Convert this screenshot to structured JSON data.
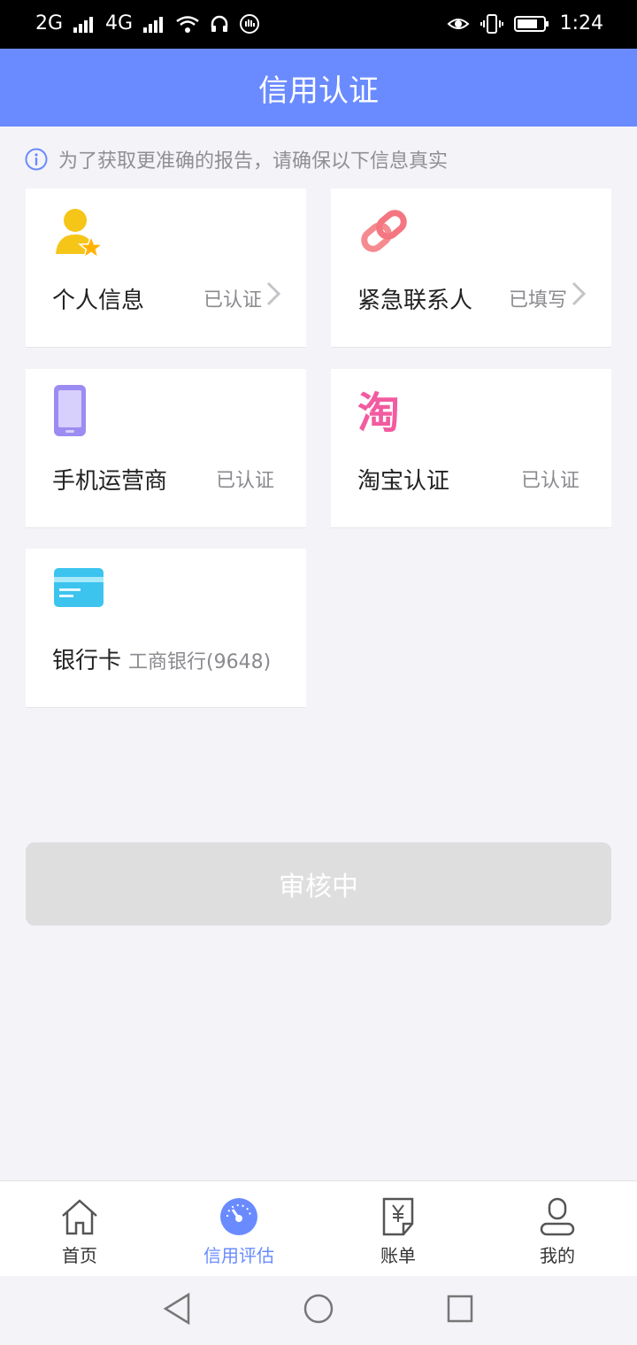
{
  "status_bar": {
    "signal_1": "2G",
    "signal_2": "4G",
    "time": "1:24"
  },
  "header": {
    "title": "信用认证"
  },
  "notice": {
    "text": "为了获取更准确的报告，请确保以下信息真实"
  },
  "cards": [
    {
      "label": "个人信息",
      "status": "已认证",
      "icon": "user-star-icon"
    },
    {
      "label": "紧急联系人",
      "status": "已填写",
      "icon": "link-icon"
    },
    {
      "label": "手机运营商",
      "status": "已认证",
      "icon": "phone-icon"
    },
    {
      "label": "淘宝认证",
      "status": "已认证",
      "icon": "taobao-icon"
    },
    {
      "label": "银行卡",
      "sub": "工商银行(9648)",
      "icon": "bank-card-icon"
    }
  ],
  "button": {
    "label": "审核中"
  },
  "tabs": [
    {
      "label": "首页",
      "icon": "home-icon",
      "active": false
    },
    {
      "label": "信用评估",
      "icon": "gauge-icon",
      "active": true
    },
    {
      "label": "账单",
      "icon": "bill-icon",
      "active": false
    },
    {
      "label": "我的",
      "icon": "profile-icon",
      "active": false
    }
  ],
  "colors": {
    "primary": "#6a8bff",
    "background": "#f4f3f7",
    "button_disabled": "#dedede"
  }
}
